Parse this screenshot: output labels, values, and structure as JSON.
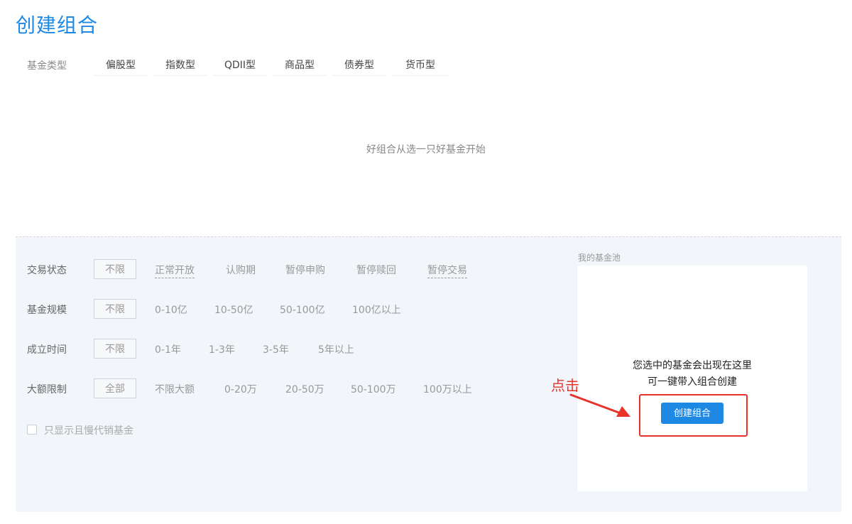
{
  "page_title": "创建组合",
  "fund_types": {
    "label": "基金类型",
    "tabs": [
      "偏股型",
      "指数型",
      "QDII型",
      "商品型",
      "债券型",
      "货币型"
    ]
  },
  "empty_hint": "好组合从选一只好基金开始",
  "filters": {
    "trade_status": {
      "label": "交易状态",
      "selected": "不限",
      "options": [
        "正常开放",
        "认购期",
        "暂停申购",
        "暂停赎回",
        "暂停交易"
      ]
    },
    "fund_size": {
      "label": "基金规模",
      "selected": "不限",
      "options": [
        "0-10亿",
        "10-50亿",
        "50-100亿",
        "100亿以上"
      ]
    },
    "establish_time": {
      "label": "成立时间",
      "selected": "不限",
      "options": [
        "0-1年",
        "1-3年",
        "3-5年",
        "5年以上"
      ]
    },
    "large_limit": {
      "label": "大额限制",
      "selected": "全部",
      "options": [
        "不限大额",
        "0-20万",
        "20-50万",
        "50-100万",
        "100万以上"
      ]
    },
    "checkbox_label": "只显示且慢代销基金"
  },
  "fund_pool": {
    "title": "我的基金池",
    "message_line1": "您选中的基金会出现在这里",
    "message_line2": "可一键带入组合创建",
    "create_button": "创建组合"
  },
  "annotation": {
    "text": "点击",
    "color": "#e8332b"
  },
  "colors": {
    "accent": "#1e88e5",
    "panel_bg": "#f2f5f9"
  }
}
